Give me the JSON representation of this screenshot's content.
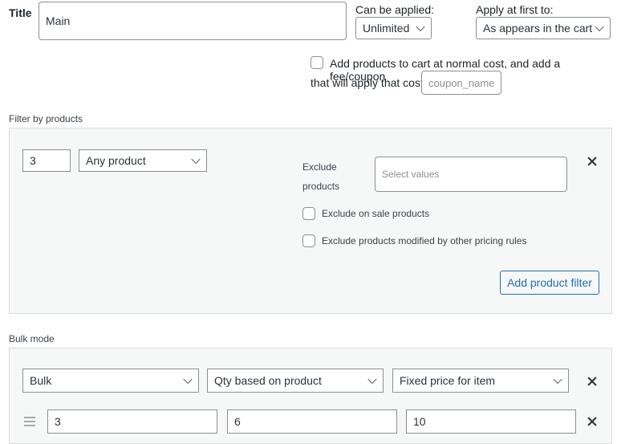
{
  "rule": {
    "title_label": "Title",
    "title_value": "Main",
    "can_be_applied_label": "Can be applied:",
    "can_be_applied_value": "Unlimited",
    "apply_first_label": "Apply at first to:",
    "apply_first_value": "As appears in the cart",
    "add_products_text_1": "Add products to cart at normal cost, and add a fee/coupon",
    "add_products_text_2": "that will apply that cost",
    "coupon_placeholder": "coupon_name"
  },
  "filter": {
    "section_label": "Filter by products",
    "qty_value": "3",
    "product_select": "Any product",
    "exclude_label_1": "Exclude",
    "exclude_label_2": "products",
    "exclude_placeholder": "Select values",
    "exclude_on_sale": "Exclude on sale products",
    "exclude_modified": "Exclude products modified by other pricing rules",
    "add_filter_button": "Add product filter"
  },
  "bulk": {
    "section_label": "Bulk mode",
    "mode_select": "Bulk",
    "qty_basis_select": "Qty based on product",
    "price_type_select": "Fixed price for item",
    "range_row": {
      "from": "3",
      "to": "6",
      "value": "10"
    }
  }
}
